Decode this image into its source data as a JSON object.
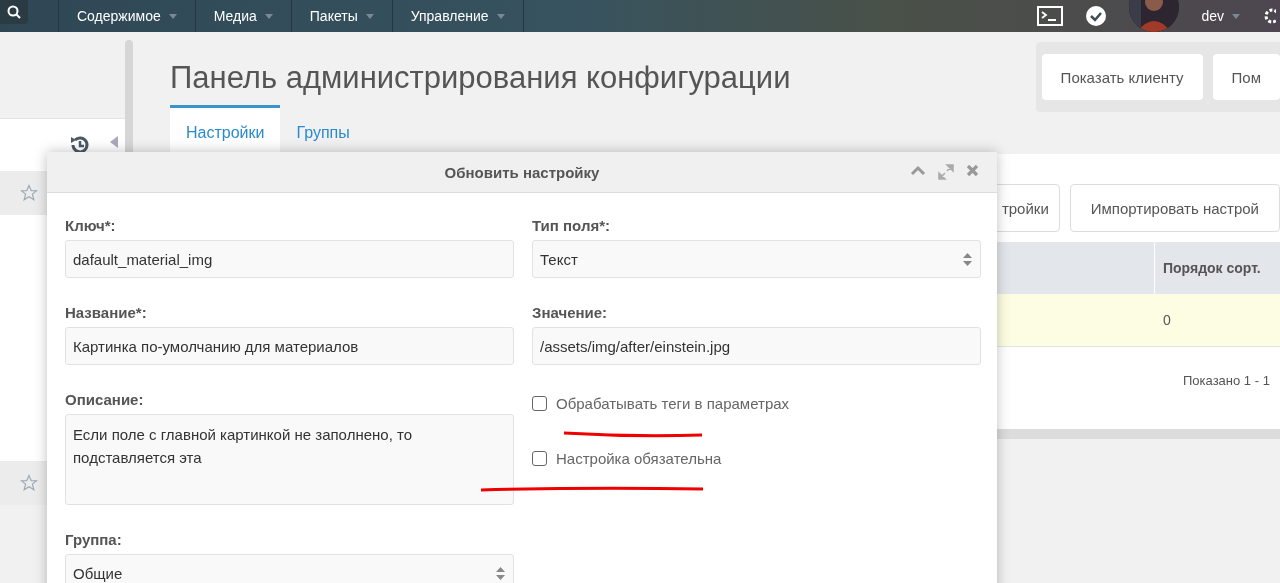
{
  "top_nav": {
    "items": [
      "Содержимое",
      "Медиа",
      "Пакеты",
      "Управление"
    ],
    "user": "dev"
  },
  "page": {
    "title": "Панель администрирования конфигурации",
    "header_buttons": [
      "Показать клиенту",
      "Пом"
    ],
    "tabs": [
      {
        "label": "Настройки",
        "selected": true
      },
      {
        "label": "Группы",
        "selected": false
      }
    ]
  },
  "background_panel": {
    "buttons": [
      "тройки",
      "Импортировать настрой"
    ],
    "table": {
      "columns": [
        "Порядок сорт."
      ],
      "rows": [
        {
          "cells": [
            "0"
          ],
          "highlighted": true
        }
      ]
    },
    "pagination": "Показано 1 - 1"
  },
  "dialog": {
    "title": "Обновить настройку",
    "left_fields": [
      {
        "kind": "text",
        "label": "Ключ*:",
        "value": "dafault_material_img"
      },
      {
        "kind": "text",
        "label": "Название*:",
        "value": "Картинка по-умолчанию для материалов"
      },
      {
        "kind": "textarea",
        "label": "Описание:",
        "value": "Если поле с главной картинкой не заполнено, то подставляется эта"
      },
      {
        "kind": "select",
        "label": "Группа:",
        "value": "Общие"
      }
    ],
    "right_fields": [
      {
        "kind": "select",
        "label": "Тип поля*:",
        "value": "Текст"
      },
      {
        "kind": "text",
        "label": "Значение:",
        "value": "/assets/img/after/einstein.jpg"
      }
    ],
    "checkboxes": [
      {
        "label": "Обрабатывать теги в параметрах",
        "checked": false
      },
      {
        "label": "Настройка обязательна",
        "checked": false
      }
    ]
  }
}
